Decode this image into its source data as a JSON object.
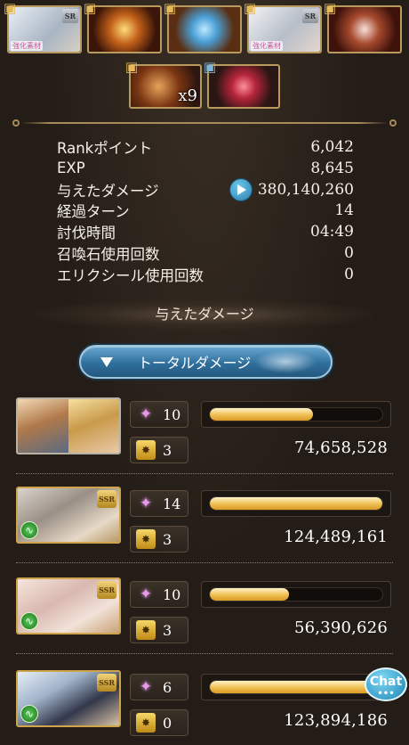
{
  "rewards_row1": [
    {
      "tag": "強化素材",
      "badge": "SR"
    },
    {
      "tag": "",
      "badge": ""
    },
    {
      "tag": "",
      "badge": ""
    },
    {
      "tag": "強化素材",
      "badge": "SR"
    },
    {
      "tag": "",
      "badge": ""
    }
  ],
  "rewards_row2": [
    {
      "qty": "x9"
    },
    {
      "qty": ""
    }
  ],
  "stats": [
    {
      "label": "Rankポイント",
      "value": "6,042"
    },
    {
      "label": "EXP",
      "value": "8,645"
    },
    {
      "label": "与えたダメージ",
      "value": "380,140,260"
    },
    {
      "label": "経過ターン",
      "value": "14"
    },
    {
      "label": "討伐時間",
      "value": "04:49"
    },
    {
      "label": "召喚石使用回数",
      "value": "0"
    },
    {
      "label": "エリクシール使用回数",
      "value": "0"
    }
  ],
  "section_heading": "与えたダメージ",
  "total_damage_button": "トータルダメージ",
  "members": [
    {
      "skills": "10",
      "ougi": "3",
      "damage": "74,658,528",
      "gauge_fill": 0.6,
      "ssr": "",
      "element": ""
    },
    {
      "skills": "14",
      "ougi": "3",
      "damage": "124,489,161",
      "gauge_fill": 1.0,
      "ssr": "SSR",
      "element": "wind"
    },
    {
      "skills": "10",
      "ougi": "3",
      "damage": "56,390,626",
      "gauge_fill": 0.46,
      "ssr": "SSR",
      "element": "wind"
    },
    {
      "skills": "6",
      "ougi": "0",
      "damage": "123,894,186",
      "gauge_fill": 1.0,
      "ssr": "SSR",
      "element": "wind"
    }
  ],
  "chat_label": "Chat",
  "chat_dots": "•••"
}
